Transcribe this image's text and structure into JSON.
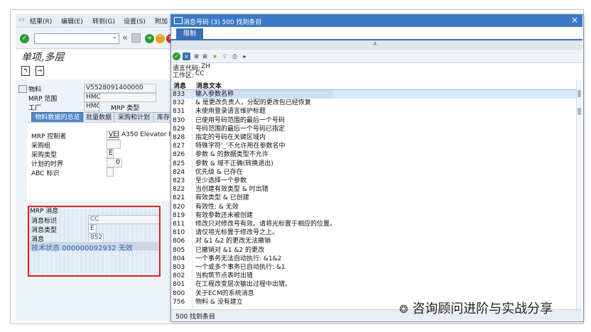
{
  "main_window": {
    "menu": [
      "结果(R)",
      "编辑(E)",
      "转到(G)",
      "设置(S)",
      "附加"
    ],
    "command_field": "",
    "title": "单项,多层",
    "fields": {
      "material_label": "物料",
      "material_value": "V5528091400000",
      "mrp_area_label": "MRP 范围",
      "mrp_area_value": "HMC",
      "plant_label": "工厂",
      "plant_value": "HMC",
      "mrp_type_label": "MRP 类型"
    },
    "tabs": [
      "物料数据的总览",
      "批量数据",
      "采购和计划",
      "库存"
    ],
    "overview": {
      "mrp_controller_label": "MRP 控制者",
      "mrp_controller_value": "VEE",
      "mrp_controller_desc": "A350 Elevator In",
      "purch_group_label": "采购组",
      "purch_group_value": "",
      "proc_type_label": "采购类型",
      "proc_type_value": "E",
      "plan_time_label": "计划的时界",
      "plan_time_value": "0",
      "abc_label": "ABC 标识",
      "abc_value": ""
    },
    "mrp_msg": {
      "section_title": "MRP 消息",
      "msg_id_label": "消息标识",
      "msg_id_value": "CC",
      "msg_type_label": "消息类型",
      "msg_type_value": "E",
      "msg_label": "消息",
      "msg_value": "852",
      "tech_status": "技术状态 000000092932 无效"
    }
  },
  "dialog": {
    "title": "消息号码 (3)  500 找到条目",
    "tab": "限制",
    "language_label": "语言代码:",
    "language_value": "ZH",
    "work_area_label": "工作区:",
    "work_area_value": "CC",
    "col_msg": "消息",
    "col_text": "消息文本",
    "rows": [
      {
        "num": "833",
        "text": "输入参数名称"
      },
      {
        "num": "832",
        "text": "& 是更改负责人，分配的更改包已经恢复"
      },
      {
        "num": "831",
        "text": "未使用登录语言维护标题"
      },
      {
        "num": "830",
        "text": "已使用号码范围的最后一个号码"
      },
      {
        "num": "829",
        "text": "号码范围的最后一个号码已指定"
      },
      {
        "num": "828",
        "text": "指定的号码在关键区域内"
      },
      {
        "num": "827",
        "text": "特殊字符'_'不允许用在参数名中"
      },
      {
        "num": "826",
        "text": "参数 & 的数据类型不允许"
      },
      {
        "num": "825",
        "text": "参数 & 域不正确(转换退出)"
      },
      {
        "num": "824",
        "text": "优先级 & 已存在"
      },
      {
        "num": "823",
        "text": "至少选择一个参数"
      },
      {
        "num": "822",
        "text": "当创建有效类型 & 时出错"
      },
      {
        "num": "821",
        "text": "有效类型 & 已创建"
      },
      {
        "num": "820",
        "text": "有效性: & 无效"
      },
      {
        "num": "819",
        "text": "有效参数还未被创建"
      },
      {
        "num": "811",
        "text": "修改只对修改号有效。请将光标置于相应的位置。"
      },
      {
        "num": "810",
        "text": "请仅将光标置于修改号之上。"
      },
      {
        "num": "806",
        "text": "对 &1 &2 的更改无法撤销"
      },
      {
        "num": "805",
        "text": "已撤销对 &1 &2 的更改"
      },
      {
        "num": "804",
        "text": "一个事务无法自动执行: &1&2"
      },
      {
        "num": "803",
        "text": "一个或多个事务已自动执行: &1"
      },
      {
        "num": "802",
        "text": "当构筑节点表时出错"
      },
      {
        "num": "801",
        "text": "在工程改变层次输出过程中出错。"
      },
      {
        "num": "800",
        "text": "关于ECM的系统消息"
      },
      {
        "num": "756",
        "text": "物料 & 没有建立"
      }
    ],
    "status": "500 找到条目"
  },
  "watermark": "咨询顾问进阶与实战分享",
  "colors": {
    "titlebar": "#3c79c7",
    "active_tab": "#4f86c6",
    "highlight_box": "#e02020"
  }
}
